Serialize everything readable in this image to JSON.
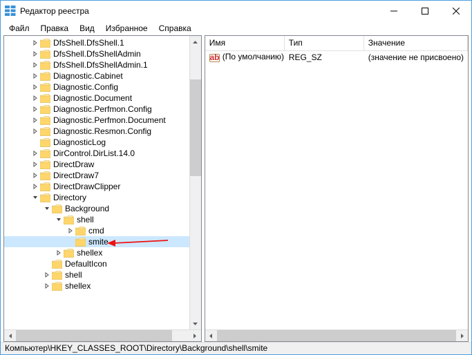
{
  "window": {
    "title": "Редактор реестра"
  },
  "menu": {
    "file": "Файл",
    "edit": "Правка",
    "view": "Вид",
    "favorites": "Избранное",
    "help": "Справка"
  },
  "tree": [
    {
      "lvl": 2,
      "exp": "right",
      "label": "DfsShell.DfsShell.1"
    },
    {
      "lvl": 2,
      "exp": "right",
      "label": "DfsShell.DfsShellAdmin"
    },
    {
      "lvl": 2,
      "exp": "right",
      "label": "DfsShell.DfsShellAdmin.1"
    },
    {
      "lvl": 2,
      "exp": "right",
      "label": "Diagnostic.Cabinet"
    },
    {
      "lvl": 2,
      "exp": "right",
      "label": "Diagnostic.Config"
    },
    {
      "lvl": 2,
      "exp": "right",
      "label": "Diagnostic.Document"
    },
    {
      "lvl": 2,
      "exp": "right",
      "label": "Diagnostic.Perfmon.Config"
    },
    {
      "lvl": 2,
      "exp": "right",
      "label": "Diagnostic.Perfmon.Document"
    },
    {
      "lvl": 2,
      "exp": "right",
      "label": "Diagnostic.Resmon.Config"
    },
    {
      "lvl": 2,
      "exp": "none",
      "label": "DiagnosticLog"
    },
    {
      "lvl": 2,
      "exp": "right",
      "label": "DirControl.DirList.14.0"
    },
    {
      "lvl": 2,
      "exp": "right",
      "label": "DirectDraw"
    },
    {
      "lvl": 2,
      "exp": "right",
      "label": "DirectDraw7"
    },
    {
      "lvl": 2,
      "exp": "right",
      "label": "DirectDrawClipper"
    },
    {
      "lvl": 2,
      "exp": "down",
      "label": "Directory"
    },
    {
      "lvl": 3,
      "exp": "down",
      "label": "Background"
    },
    {
      "lvl": 4,
      "exp": "down",
      "label": "shell"
    },
    {
      "lvl": 5,
      "exp": "right",
      "label": "cmd"
    },
    {
      "lvl": 5,
      "exp": "none",
      "label": "smite",
      "selected": true,
      "annot": true
    },
    {
      "lvl": 4,
      "exp": "right",
      "label": "shellex"
    },
    {
      "lvl": 3,
      "exp": "none",
      "label": "DefaultIcon"
    },
    {
      "lvl": 3,
      "exp": "right",
      "label": "shell"
    },
    {
      "lvl": 3,
      "exp": "right",
      "label": "shellex"
    }
  ],
  "list": {
    "cols": {
      "name": "Имя",
      "type": "Тип",
      "value": "Значение"
    },
    "rows": [
      {
        "name": "(По умолчанию)",
        "type": "REG_SZ",
        "value": "(значение не присвоено)"
      }
    ]
  },
  "statusbar": "Компьютер\\HKEY_CLASSES_ROOT\\Directory\\Background\\shell\\smite"
}
